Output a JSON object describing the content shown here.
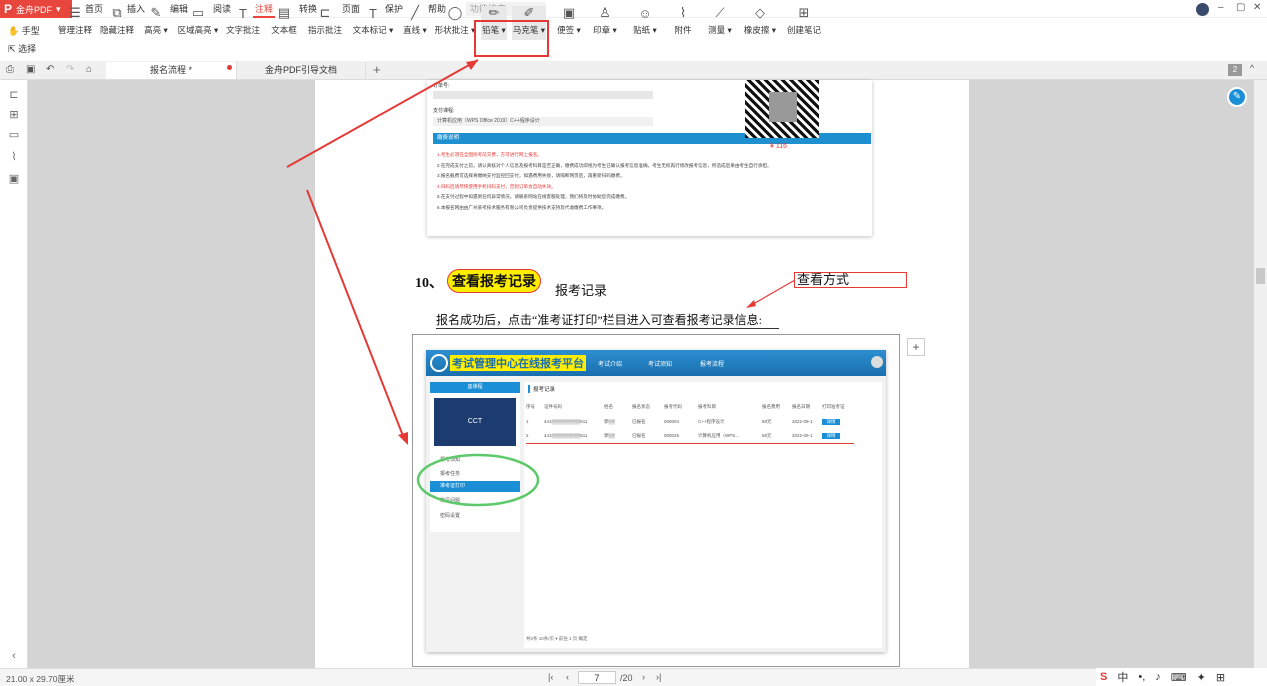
{
  "app": {
    "name": "金舟PDF",
    "dropdown": "▾"
  },
  "menu": [
    "首页",
    "插入",
    "编辑",
    "阅读",
    "注释",
    "转换",
    "页面",
    "保护",
    "帮助"
  ],
  "active_menu": "注释",
  "search_placeholder": "功能搜索",
  "left_tools": [
    {
      "label": "手型"
    },
    {
      "label": "选择"
    }
  ],
  "tools": [
    {
      "label": "管理注释"
    },
    {
      "label": "隐藏注释"
    },
    {
      "label": "高亮 ▾"
    },
    {
      "label": "区域高亮 ▾"
    },
    {
      "label": "文字批注"
    },
    {
      "label": "文本框"
    },
    {
      "label": "指示批注"
    },
    {
      "label": "文本标记 ▾"
    },
    {
      "label": "直线 ▾"
    },
    {
      "label": "形状批注 ▾"
    },
    {
      "label": "铅笔 ▾"
    },
    {
      "label": "马克笔 ▾"
    },
    {
      "label": "便签 ▾"
    },
    {
      "label": "印章 ▾"
    },
    {
      "label": "贴纸 ▾"
    },
    {
      "label": "附件"
    },
    {
      "label": "测量 ▾"
    },
    {
      "label": "橡皮擦 ▾"
    },
    {
      "label": "创建笔记"
    }
  ],
  "tabs": [
    {
      "label": "报名流程 *"
    },
    {
      "label": "金舟PDF引导文档"
    }
  ],
  "page_badge": "2",
  "doc": {
    "order_label": "订单号:",
    "course_label": "支付课程:",
    "course_value": "计算机应用（WPS Office 2019）C++程序设计",
    "notice_title": "缴费说明",
    "notice_lines": [
      "1.考生必须在全国统考前交费，方可进行网上报名。",
      "2.在完成支付之前，请认真核对个人信息及报考科目是否正确，缴费成功即视为考生已确认报考信息准确，考生无权再行修改报考信息，所造成后果由考生自行承担。",
      "3.报名截费可选择将缴纳支付监控回支付，如遇费用失败，请隔断网页后，再重新扫码缴费。",
      "4.扫码后请尽快使用手机扫码支付，否则订单会自动失效。",
      "5.在支付过程中如遇到任何异常情况，请联系网站在线客服处理，我们将及时协助您完成缴费。",
      "6.本报名网由由广州某考技术服务有限公司负责提供技术支持及代收缴费工作事项。"
    ],
    "price": "¥ 116",
    "heading_num": "10、",
    "heading_text": "查看报考记录",
    "heading_suffix": "报考记录",
    "note_text": "查看方式",
    "para": "报名成功后，点击“准考证打印”栏目进入可查看报考记录信息:"
  },
  "shot": {
    "site_title": "考试管理中心在线报考平台",
    "nav": [
      "考试介绍",
      "考试须知",
      "报考流程"
    ],
    "side_top": "座课程",
    "side_items": [
      "报考须知",
      "报考任务",
      "准考证打印",
      "常见问题",
      "密码设置"
    ],
    "panel_title": "报考记录",
    "cols": [
      "序号",
      "证件号码",
      "姓名",
      "报名状态",
      "报考代码",
      "报考科目",
      "报名费用",
      "报名日期",
      "打印准考证"
    ],
    "rows": [
      [
        "1",
        "441▒▒▒▒▒▒▒▒▒511",
        "郭▒▒",
        "已报名",
        "000004",
        "C++程序设计",
        "58元",
        "2022-09-1",
        "详情"
      ],
      [
        "2",
        "441▒▒▒▒▒▒▒▒▒511",
        "郭▒▒",
        "已报名",
        "000025",
        "计算机应用（WPS...",
        "58元",
        "2022-09-1",
        "详情"
      ]
    ],
    "pager": "共2条  10条/页 ▾  前往  1  页  确定"
  },
  "status": {
    "size": "21.00 x 29.70厘米",
    "page": "7",
    "total": "/20"
  },
  "ime": "中"
}
